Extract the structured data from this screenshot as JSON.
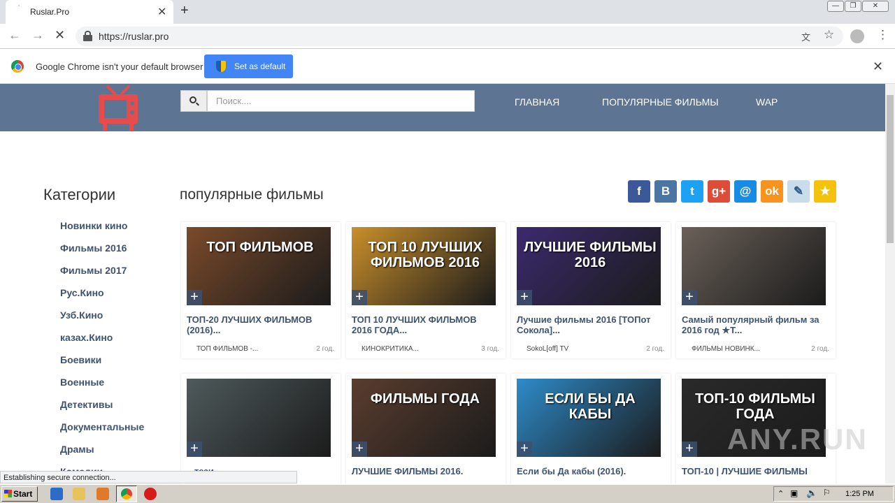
{
  "browser": {
    "tab_title": "Ruslar.Pro",
    "url": "https://ruslar.pro",
    "infobar_text": "Google Chrome isn't your default browser",
    "set_default_label": "Set as default",
    "status_text": "Establishing secure connection..."
  },
  "site": {
    "search_placeholder": "Поиск....",
    "nav": [
      "ГЛАВНАЯ",
      "ПОПУЛЯРНЫЕ ФИЛЬМЫ",
      "WAP"
    ],
    "categories_heading": "Категории",
    "categories": [
      "Новинки кино",
      "Фильмы 2016",
      "Фильмы 2017",
      "Рус.Кино",
      "Узб.Кино",
      "казах.Кино",
      "Боевики",
      "Военные",
      "Детективы",
      "Документальные",
      "Драмы",
      "Комедии"
    ],
    "section_title": "популярные фильмы",
    "share_icons": [
      {
        "name": "facebook-icon",
        "glyph": "f",
        "color": "#3b5998"
      },
      {
        "name": "vk-icon",
        "glyph": "B",
        "color": "#4c75a3"
      },
      {
        "name": "twitter-icon",
        "glyph": "t",
        "color": "#1da1f2"
      },
      {
        "name": "google-plus-icon",
        "glyph": "g+",
        "color": "#dd4b39"
      },
      {
        "name": "mailru-icon",
        "glyph": "@",
        "color": "#168de2"
      },
      {
        "name": "odnoklassniki-icon",
        "glyph": "ok",
        "color": "#f7931e"
      },
      {
        "name": "livejournal-icon",
        "glyph": "✎",
        "color": "#c9dce9"
      },
      {
        "name": "favorite-star-icon",
        "glyph": "★",
        "color": "#f4c20d"
      }
    ],
    "cards": [
      {
        "title": "ТОП-20 ЛУЧШИХ ФИЛЬМОВ (2016)...",
        "channel": "ТОП ФИЛЬМОВ -...",
        "age": "2 год.",
        "thumb_text": "ТОП ФИЛЬМОВ",
        "bg": "#7a4a2a"
      },
      {
        "title": "ТОП 10 ЛУЧШИХ ФИЛЬМОВ 2016 ГОДА...",
        "channel": "КИНОКРИТИКА...",
        "age": "3 год.",
        "thumb_text": "ТОП 10 ЛУЧШИХ ФИЛЬМОВ 2016",
        "bg": "#c98f2a"
      },
      {
        "title": "Лучшие фильмы 2016 [ТОПот Сокола]...",
        "channel": "SokoL[off] TV",
        "age": "2 год.",
        "thumb_text": "ЛУЧШИЕ ФИЛЬМЫ 2016",
        "bg": "#3b2a6e"
      },
      {
        "title": "Самый популярный фильм за 2016 год ★Т...",
        "channel": "ФИЛЬМЫ НОВИНК...",
        "age": "2 год.",
        "thumb_text": "",
        "bg": "#6a6058"
      },
      {
        "title": "...тези",
        "channel": "",
        "age": "",
        "thumb_text": "",
        "bg": "#4e5a5c"
      },
      {
        "title": "ЛУЧШИЕ ФИЛЬМЫ 2016.",
        "channel": "",
        "age": "",
        "thumb_text": "ФИЛЬМЫ ГОДА",
        "bg": "#5a3d2e"
      },
      {
        "title": "Если бы Да кабы (2016).",
        "channel": "",
        "age": "",
        "thumb_text": "ЕСЛИ БЫ ДА КАБЫ",
        "bg": "#2e8bc9"
      },
      {
        "title": "ТОП-10 | ЛУЧШИЕ ФИЛЬМЫ",
        "channel": "",
        "age": "",
        "thumb_text": "ТОП-10 ФИЛЬМЫ ГОДА",
        "bg": "#2a2a2a"
      }
    ]
  },
  "taskbar": {
    "start_label": "Start",
    "clock": "1:25 PM",
    "watermark": "ANY.RUN"
  }
}
